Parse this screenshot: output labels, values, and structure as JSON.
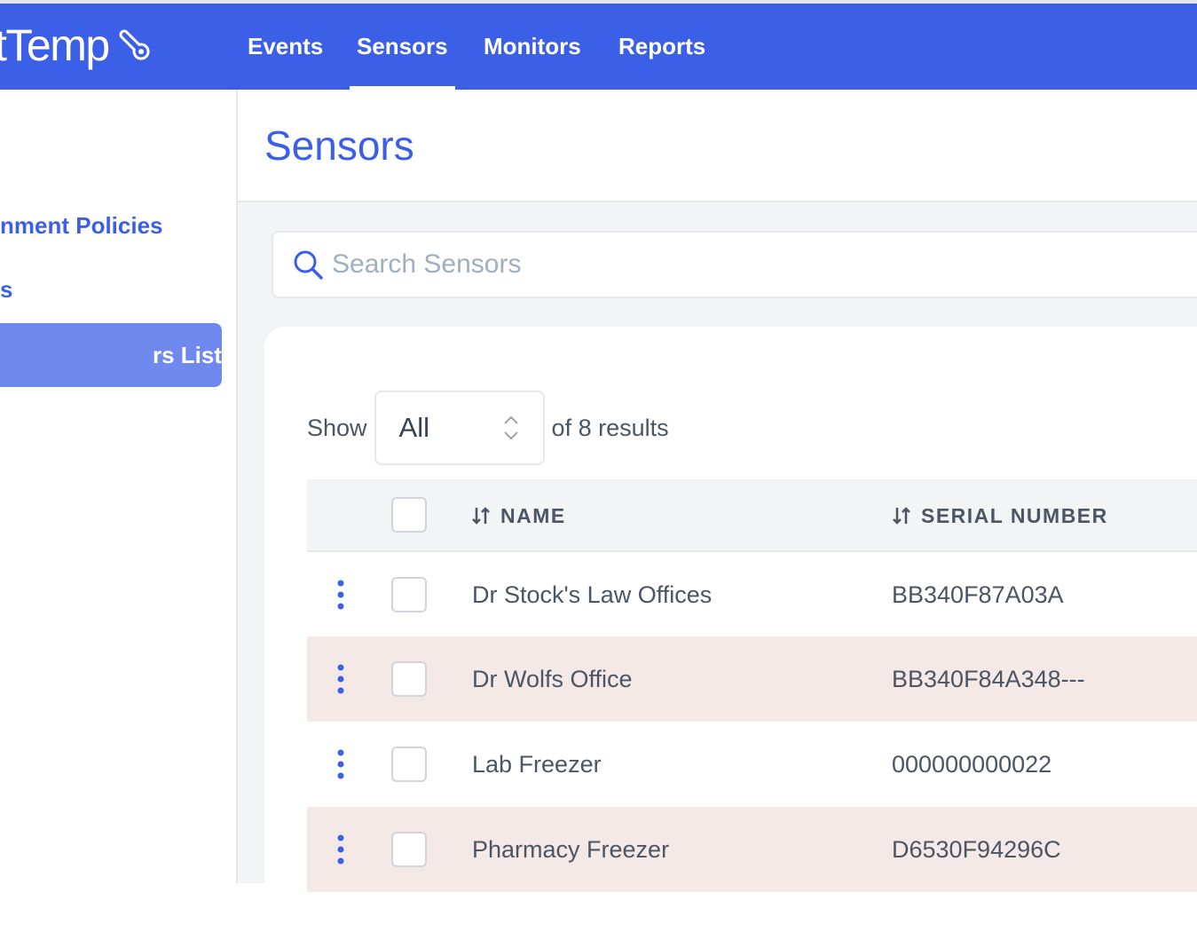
{
  "brand": {
    "name": "tTemp"
  },
  "nav": {
    "items": [
      {
        "label": "Events"
      },
      {
        "label": "Sensors"
      },
      {
        "label": "Monitors"
      },
      {
        "label": "Reports"
      }
    ],
    "active": "Sensors"
  },
  "sidebar": {
    "items": [
      {
        "label": "nment Policies"
      },
      {
        "label": "s"
      },
      {
        "label": "rs List"
      }
    ]
  },
  "page": {
    "title": "Sensors"
  },
  "search": {
    "placeholder": "Search Sensors"
  },
  "pager": {
    "show_label": "Show",
    "selected": "All",
    "summary": "of 8 results"
  },
  "table": {
    "columns": [
      {
        "label": "NAME"
      },
      {
        "label": "SERIAL NUMBER"
      }
    ],
    "rows": [
      {
        "name": "Dr Stock's Law Offices",
        "serial": "BB340F87A03A"
      },
      {
        "name": "Dr Wolfs Office",
        "serial": "BB340F84A348---"
      },
      {
        "name": "Lab Freezer",
        "serial": "000000000022"
      },
      {
        "name": "Pharmacy Freezer",
        "serial": "D6530F94296C"
      }
    ]
  },
  "colors": {
    "primary": "#3b5fe6",
    "sidebar_active": "#7089ef",
    "row_highlight": "#f5e9e8",
    "background": "#f3f4f6"
  }
}
